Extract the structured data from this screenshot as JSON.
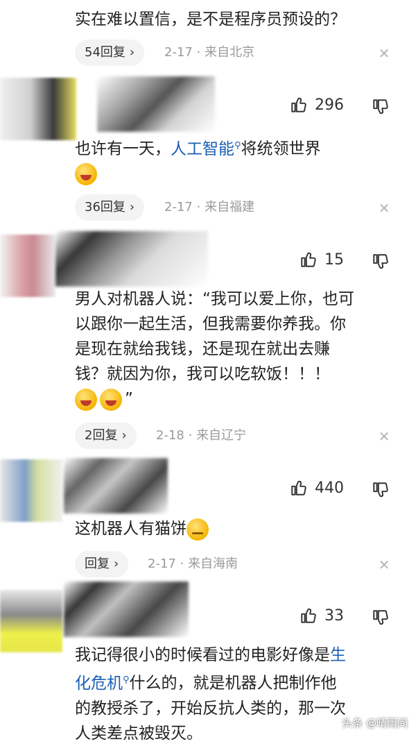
{
  "comments": [
    {
      "text": "实在难以置信，是不是程序员预设的？",
      "reply_label": "54回复",
      "date": "2-17",
      "location": "来自北京"
    },
    {
      "likes": "296",
      "text_before": "也许有一天，",
      "link": "人工智能",
      "text_after": "将统领世界",
      "reply_label": "36回复",
      "date": "2-17",
      "location": "来自福建"
    },
    {
      "likes": "15",
      "text_lines": [
        "男人对机器人说：“我可以爱上你，也可",
        "以跟你一起生活，但我需要你养我。你",
        "是现在就给我钱，还是现在就出去赚",
        "钱？就因为你，我可以吃软饭！！！"
      ],
      "text_tail": "”",
      "reply_label": "2回复",
      "date": "2-18",
      "location": "来自辽宁"
    },
    {
      "likes": "440",
      "text": "这机器人有猫饼",
      "reply_label": "回复",
      "date": "2-17",
      "location": "来自海南"
    },
    {
      "likes": "33",
      "line1_before": "我记得很小的时候看过的电影好像是",
      "line1_link": "生",
      "line2_link": "化危机",
      "line2_after": "什么的，就是机器人把制作他",
      "line3": "的教授杀了，开始反抗人类的，那一次",
      "line4": "人类差点被毁灭。"
    }
  ],
  "separator": "·",
  "watermark": "头条 @晴雨间",
  "icons": {
    "like": "thumbs-up-icon",
    "dislike": "thumbs-down-icon",
    "close": "close-icon",
    "chevron": "chevron-right-icon",
    "search": "search-icon"
  }
}
